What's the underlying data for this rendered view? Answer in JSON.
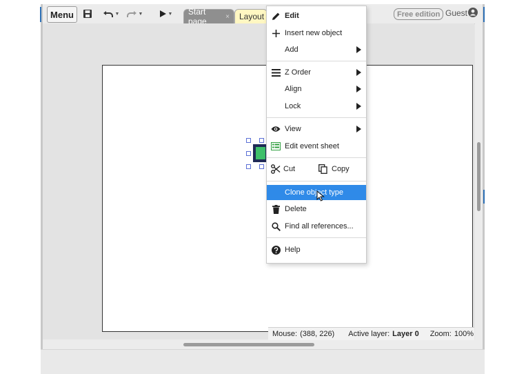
{
  "toolbar": {
    "menu_label": "Menu",
    "save_icon": "save-icon",
    "undo_icon": "undo-icon",
    "redo_icon": "redo-icon",
    "play_icon": "play-icon"
  },
  "tabs": [
    {
      "label": "Start page",
      "close": "×"
    },
    {
      "label": "Layout 1"
    }
  ],
  "account": {
    "edition_badge": "Free edition",
    "user_label": "Guest"
  },
  "context_menu": {
    "items": [
      {
        "label": "Edit",
        "icon": "pencil-icon"
      },
      {
        "label": "Insert new object",
        "icon": "plus-icon"
      },
      {
        "label": "Add",
        "icon": ""
      },
      {
        "label": "Z Order",
        "icon": "layers-icon"
      },
      {
        "label": "Align",
        "icon": ""
      },
      {
        "label": "Lock",
        "icon": ""
      },
      {
        "label": "View",
        "icon": "eye-icon"
      },
      {
        "label": "Edit event sheet",
        "icon": "event-sheet-icon"
      },
      {
        "label": "Cut",
        "icon": "scissors-icon"
      },
      {
        "label": "Copy",
        "icon": "copy-icon"
      },
      {
        "label": "Clone object type",
        "icon": ""
      },
      {
        "label": "Delete",
        "icon": "trash-icon"
      },
      {
        "label": "Find all references...",
        "icon": "search-icon"
      },
      {
        "label": "Help",
        "icon": "help-icon"
      }
    ]
  },
  "status": {
    "mouse_label": "Mouse:",
    "mouse_value": "(388, 226)",
    "layer_label": "Active layer:",
    "layer_value": "Layer 0",
    "zoom_label": "Zoom:",
    "zoom_value": "100%"
  },
  "colors": {
    "highlight": "#2f8ae8",
    "sprite_border": "#1f2a55",
    "sprite_fill": "#3ec06a"
  }
}
